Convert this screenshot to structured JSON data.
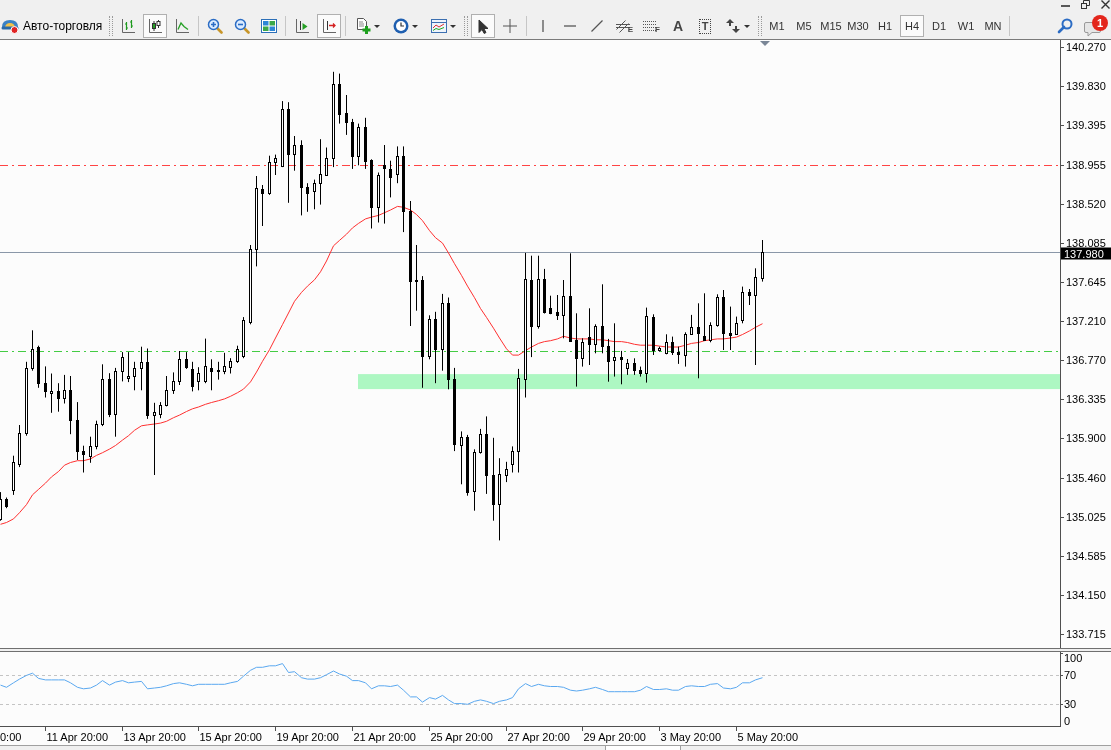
{
  "window_controls": [
    {
      "kind": "minimize"
    },
    {
      "kind": "restore"
    },
    {
      "kind": "close"
    }
  ],
  "toolbar": {
    "auto_trading": {
      "label": "Авто-торговля"
    },
    "groups": [
      {
        "separator": {
          "kind": "grip"
        },
        "tools": [
          {
            "kind": "bars",
            "on": false
          },
          {
            "kind": "candles",
            "on": true
          },
          {
            "kind": "line",
            "on": false
          }
        ]
      },
      {
        "separator": {
          "kind": "line"
        },
        "tools": [
          {
            "kind": "zoom-in",
            "on": false
          },
          {
            "kind": "zoom-out",
            "on": false
          },
          {
            "kind": "tile",
            "on": false
          }
        ]
      },
      {
        "separator": {
          "kind": "line"
        },
        "tools": [
          {
            "kind": "shift",
            "on": false
          },
          {
            "kind": "autoscroll",
            "on": true
          }
        ]
      },
      {
        "separator": {
          "kind": "line"
        },
        "tools": [
          {
            "kind": "new-chart",
            "on": false,
            "dropdown": true
          },
          {
            "kind": "periods",
            "on": false,
            "dropdown": true
          },
          {
            "kind": "template",
            "on": false,
            "dropdown": true
          }
        ]
      },
      {
        "separator": {
          "kind": "grip"
        },
        "tools": [
          {
            "kind": "cursor",
            "on": true
          },
          {
            "kind": "crosshair",
            "on": false
          }
        ]
      },
      {
        "separator": {
          "kind": "line"
        },
        "tools": [
          {
            "kind": "vline",
            "on": false
          },
          {
            "kind": "hline",
            "on": false
          },
          {
            "kind": "trendline",
            "on": false
          },
          {
            "kind": "channel",
            "on": false,
            "glyph": "E"
          },
          {
            "kind": "fibonacci",
            "on": false,
            "glyph": "F"
          },
          {
            "kind": "text",
            "on": false,
            "glyph": "A"
          },
          {
            "kind": "label",
            "on": false,
            "glyph": "T"
          },
          {
            "kind": "arrows",
            "on": false,
            "dropdown": true
          }
        ]
      }
    ],
    "timeframes_separator": {
      "kind": "grip"
    },
    "timeframes": [
      {
        "label": "M1",
        "selected": false
      },
      {
        "label": "M5",
        "selected": false
      },
      {
        "label": "M15",
        "selected": false
      },
      {
        "label": "M30",
        "selected": false
      },
      {
        "label": "H1",
        "selected": false
      },
      {
        "label": "H4",
        "selected": true
      },
      {
        "label": "D1",
        "selected": false
      },
      {
        "label": "W1",
        "selected": false
      },
      {
        "label": "MN",
        "selected": false
      }
    ],
    "end_separator": {
      "kind": "line"
    },
    "chat": {
      "badge": "1"
    }
  },
  "chart": {
    "time_axis": {
      "leading_label": "0:00",
      "labels": [
        "11 Apr 20:00",
        "13 Apr 20:00",
        "15 Apr 20:00",
        "19 Apr 20:00",
        "21 Apr 20:00",
        "25 Apr 20:00",
        "27 Apr 20:00",
        "29 Apr 20:00",
        "3 May 20:00",
        "5 May 20:00"
      ]
    },
    "chart_data": [
      {
        "type": "candlestick",
        "ylim": [
          133.559,
          140.348
        ],
        "tick_labels": "y",
        "yticks": [
          {
            "value": 140.27,
            "label": "140.270"
          },
          {
            "value": 139.83,
            "label": "139.830"
          },
          {
            "value": 139.395,
            "label": "139.395"
          },
          {
            "value": 138.955,
            "label": "138.955"
          },
          {
            "value": 138.52,
            "label": "138.520"
          },
          {
            "value": 138.085,
            "label": "138.085"
          },
          {
            "value": 137.645,
            "label": "137.645"
          },
          {
            "value": 137.21,
            "label": "137.210"
          },
          {
            "value": 136.77,
            "label": "136.770"
          },
          {
            "value": 136.335,
            "label": "136.335"
          },
          {
            "value": 135.9,
            "label": "135.900"
          },
          {
            "value": 135.46,
            "label": "135.460"
          },
          {
            "value": 135.025,
            "label": "135.025"
          },
          {
            "value": 134.585,
            "label": "134.585"
          },
          {
            "value": 134.15,
            "label": "134.150"
          },
          {
            "value": 133.715,
            "label": "133.715"
          }
        ],
        "ref_lines": [
          {
            "axis": "y",
            "value": 138.955,
            "color": "#ff4444",
            "line_style": "dashdot"
          },
          {
            "axis": "y",
            "value": 136.875,
            "color": "#44cc44",
            "line_style": "dashdot"
          },
          {
            "axis": "y",
            "value": 137.98,
            "color": "#8a97a8",
            "line_style": "solid",
            "label": "137.980"
          }
        ],
        "bands": [
          {
            "axis": "y",
            "from": 136.45,
            "to": 136.617,
            "color": "#adf7c2"
          }
        ],
        "series": [
          {
            "type": "line",
            "color": "#ff3030",
            "values": [
              134.94,
              134.96,
              135.0,
              135.07,
              135.16,
              135.27,
              135.33,
              135.4,
              135.47,
              135.53,
              135.6,
              135.63,
              135.65,
              135.65,
              135.67,
              135.71,
              135.74,
              135.78,
              135.82,
              135.88,
              135.93,
              135.99,
              136.04,
              136.05,
              136.06,
              136.07,
              136.09,
              136.13,
              136.16,
              136.2,
              136.23,
              136.25,
              136.28,
              136.3,
              136.32,
              136.34,
              136.37,
              136.41,
              136.45,
              136.53,
              136.64,
              136.76,
              136.89,
              137.02,
              137.17,
              137.3,
              137.43,
              137.53,
              137.6,
              137.67,
              137.76,
              137.88,
              138.05,
              138.11,
              138.18,
              138.25,
              138.3,
              138.35,
              138.37,
              138.39,
              138.42,
              138.45,
              138.49,
              138.48,
              138.45,
              138.4,
              138.33,
              138.22,
              138.14,
              138.08,
              137.97,
              137.85,
              137.72,
              137.6,
              137.47,
              137.35,
              137.25,
              137.13,
              137.02,
              136.9,
              136.83,
              136.83,
              136.88,
              136.92,
              136.96,
              136.98,
              136.99,
              137.01,
              137.04,
              137.02,
              137.01,
              137.01,
              137.01,
              137.0,
              137.0,
              136.99,
              136.98,
              136.98,
              136.97,
              136.95,
              136.94,
              136.94,
              136.94,
              136.93,
              136.92,
              136.92,
              136.92,
              136.94,
              136.96,
              136.97,
              136.99,
              137.0,
              137.01,
              137.01,
              137.02,
              137.03,
              137.06,
              137.1,
              137.14,
              137.18
            ]
          },
          {
            "type": "candlestick",
            "ohlc": [
              [
                135.0,
                135.3,
                134.981,
                135.22
              ],
              [
                135.22,
                135.24,
                135.12,
                135.14
              ],
              [
                135.32,
                135.706,
                135.268,
                135.638
              ],
              [
                135.619,
                136.049,
                135.579,
                135.958
              ],
              [
                135.958,
                136.755,
                135.93,
                136.687
              ],
              [
                136.687,
                137.106,
                136.655,
                136.895
              ],
              [
                136.915,
                136.935,
                136.464,
                136.516
              ],
              [
                136.516,
                136.703,
                136.356,
                136.424
              ],
              [
                136.404,
                136.624,
                136.185,
                136.428
              ],
              [
                136.424,
                136.516,
                136.197,
                136.356
              ],
              [
                136.356,
                136.608,
                136.289,
                136.444
              ],
              [
                136.436,
                136.596,
                135.946,
                136.105
              ],
              [
                136.105,
                136.305,
                135.658,
                135.758
              ],
              [
                135.758,
                135.818,
                135.519,
                135.73
              ],
              [
                135.698,
                135.918,
                135.627,
                135.818
              ],
              [
                135.818,
                136.097,
                135.778,
                136.057
              ],
              [
                136.057,
                136.727,
                136.037,
                136.568
              ],
              [
                136.568,
                136.628,
                136.137,
                136.169
              ],
              [
                136.169,
                136.687,
                135.918,
                136.648
              ],
              [
                136.648,
                136.863,
                136.536,
                136.803
              ],
              [
                136.576,
                136.863,
                136.528,
                136.6
              ],
              [
                136.596,
                136.755,
                136.436,
                136.687
              ],
              [
                136.687,
                136.923,
                136.436,
                136.755
              ],
              [
                136.755,
                136.903,
                136.117,
                136.157
              ],
              [
                136.157,
                136.297,
                135.491,
                136.193
              ],
              [
                136.177,
                136.305,
                136.125,
                136.277
              ],
              [
                136.277,
                136.596,
                136.257,
                136.436
              ],
              [
                136.436,
                136.636,
                136.396,
                136.536
              ],
              [
                136.536,
                136.875,
                136.496,
                136.783
              ],
              [
                136.783,
                136.863,
                136.675,
                136.695
              ],
              [
                136.675,
                136.755,
                136.424,
                136.488
              ],
              [
                136.536,
                136.695,
                136.436,
                136.628
              ],
              [
                136.544,
                137.014,
                136.516,
                136.703
              ],
              [
                136.687,
                136.783,
                136.436,
                136.655
              ],
              [
                136.663,
                136.755,
                136.556,
                136.648
              ],
              [
                136.648,
                136.855,
                136.616,
                136.703
              ],
              [
                136.695,
                136.795,
                136.624,
                136.763
              ],
              [
                136.763,
                136.935,
                136.743,
                136.895
              ],
              [
                136.823,
                137.254,
                136.795,
                137.222
              ],
              [
                137.202,
                138.059,
                137.174,
                138.019
              ],
              [
                138.019,
                138.829,
                137.82,
                138.697
              ],
              [
                138.689,
                138.729,
                138.271,
                138.642
              ],
              [
                138.642,
                139.056,
                138.618,
                138.988
              ],
              [
                138.988,
                139.068,
                138.841,
                139.028
              ],
              [
                138.937,
                139.666,
                138.929,
                139.575
              ],
              [
                139.575,
                139.654,
                138.53,
                139.076
              ],
              [
                139.08,
                139.276,
                138.889,
                139.176
              ],
              [
                139.176,
                139.228,
                138.39,
                138.709
              ],
              [
                138.709,
                138.749,
                138.43,
                138.642
              ],
              [
                138.657,
                138.789,
                138.458,
                138.749
              ],
              [
                138.749,
                139.24,
                138.51,
                138.857
              ],
              [
                138.841,
                139.148,
                138.829,
                139.028
              ],
              [
                139.028,
                139.993,
                138.929,
                139.854
              ],
              [
                139.854,
                139.973,
                139.415,
                139.527
              ],
              [
                139.535,
                139.734,
                139.288,
                139.427
              ],
              [
                139.427,
                139.467,
                138.909,
                139.048
              ],
              [
                139.048,
                139.415,
                138.949,
                139.375
              ],
              [
                139.375,
                139.479,
                138.909,
                139.0
              ],
              [
                139.008,
                139.016,
                138.243,
                138.482
              ],
              [
                138.482,
                138.869,
                138.31,
                138.841
              ],
              [
                138.949,
                139.176,
                138.298,
                138.921
              ],
              [
                138.909,
                139.0,
                138.59,
                138.817
              ],
              [
                138.857,
                139.16,
                138.749,
                139.056
              ],
              [
                139.056,
                139.16,
                138.203,
                138.442
              ],
              [
                138.442,
                138.55,
                137.154,
                137.652
              ],
              [
                137.652,
                138.059,
                137.325,
                137.672
              ],
              [
                137.672,
                137.712,
                136.464,
                136.815
              ],
              [
                136.815,
                137.274,
                136.783,
                137.234
              ],
              [
                137.234,
                137.313,
                136.516,
                136.895
              ],
              [
                136.895,
                137.513,
                136.655,
                137.413
              ],
              [
                137.413,
                137.473,
                136.448,
                136.568
              ],
              [
                136.568,
                136.687,
                135.758,
                135.838
              ],
              [
                135.826,
                135.978,
                135.387,
                135.918
              ],
              [
                135.918,
                135.938,
                135.26,
                135.3
              ],
              [
                135.308,
                135.778,
                135.092,
                135.746
              ],
              [
                135.746,
                136.005,
                135.73,
                135.946
              ],
              [
                135.946,
                136.145,
                135.28,
                135.491
              ],
              [
                135.491,
                135.906,
                134.981,
                135.172
              ],
              [
                135.172,
                135.678,
                134.761,
                135.499
              ],
              [
                135.491,
                135.638,
                135.411,
                135.559
              ],
              [
                135.611,
                135.81,
                135.519,
                135.758
              ],
              [
                135.758,
                136.675,
                135.519,
                136.576
              ],
              [
                136.568,
                137.971,
                136.356,
                137.684
              ],
              [
                137.672,
                137.94,
                136.807,
                137.154
              ],
              [
                137.154,
                137.94,
                137.126,
                137.684
              ],
              [
                137.684,
                137.792,
                137.294,
                137.313
              ],
              [
                137.353,
                137.493,
                137.286,
                137.302
              ],
              [
                137.313,
                137.501,
                137.222,
                137.274
              ],
              [
                137.278,
                137.668,
                137.017,
                137.49
              ],
              [
                137.49,
                137.966,
                136.98,
                136.987
              ],
              [
                136.999,
                137.296,
                136.478,
                136.794
              ],
              [
                136.794,
                137.017,
                136.701,
                136.973
              ],
              [
                137.028,
                137.352,
                136.719,
                136.95
              ],
              [
                136.95,
                137.174,
                136.85,
                137.159
              ],
              [
                137.159,
                137.62,
                136.85,
                136.932
              ],
              [
                136.932,
                137.01,
                136.533,
                136.764
              ],
              [
                136.772,
                137.185,
                136.589,
                136.805
              ],
              [
                136.805,
                136.876,
                136.504,
                136.786
              ],
              [
                136.682,
                136.786,
                136.608,
                136.738
              ],
              [
                136.738,
                136.794,
                136.608,
                136.664
              ],
              [
                136.664,
                136.701,
                136.589,
                136.626
              ],
              [
                136.626,
                137.36,
                136.522,
                137.267
              ],
              [
                137.255,
                137.285,
                136.831,
                136.883
              ],
              [
                136.883,
                136.924,
                136.868,
                136.906
              ],
              [
                136.85,
                137.062,
                136.839,
                136.973
              ],
              [
                136.973,
                137.036,
                136.831,
                136.868
              ],
              [
                136.868,
                136.924,
                136.731,
                136.839
              ],
              [
                136.831,
                137.084,
                136.701,
                137.062
              ],
              [
                137.062,
                137.278,
                137.054,
                137.147
              ],
              [
                137.147,
                137.408,
                136.571,
                137.073
              ],
              [
                137.043,
                137.52,
                136.987,
                136.999
              ],
              [
                136.999,
                137.196,
                136.973,
                137.166
              ],
              [
                137.166,
                137.508,
                137.147,
                137.475
              ],
              [
                137.475,
                137.557,
                136.887,
                137.073
              ],
              [
                137.073,
                137.371,
                136.887,
                137.058
              ],
              [
                137.062,
                137.259,
                137.054,
                137.185
              ],
              [
                137.222,
                137.594,
                137.185,
                137.531
              ],
              [
                137.531,
                137.568,
                137.389,
                137.501
              ],
              [
                137.501,
                137.799,
                136.719,
                137.702
              ],
              [
                137.687,
                138.115,
                137.65,
                137.98
              ]
            ]
          }
        ]
      },
      {
        "type": "line",
        "ylim": [
          0,
          100
        ],
        "yticks": [
          100,
          70,
          30,
          0
        ],
        "tick_labels": "y",
        "color": "#5aa8f0",
        "ref_lines": [
          {
            "axis": "y",
            "value": 70,
            "color": "#c4c4c4",
            "line_style": "dashed"
          },
          {
            "axis": "y",
            "value": 30,
            "color": "#c4c4c4",
            "line_style": "dashed"
          }
        ],
        "values": [
          56,
          53,
          59,
          64,
          69,
          72,
          65,
          63,
          63,
          63,
          63,
          59,
          53,
          51,
          52,
          56,
          62,
          56,
          60,
          62,
          59,
          60,
          61,
          51,
          52,
          53,
          55,
          58,
          59,
          57,
          55,
          57,
          57,
          57,
          57,
          57,
          59,
          61,
          68,
          76,
          80,
          80,
          82,
          82,
          85,
          73,
          74,
          66,
          64,
          64,
          66,
          70,
          75,
          71,
          68,
          62,
          62,
          59,
          51,
          55,
          55,
          54,
          56,
          49,
          40,
          40,
          33,
          39,
          37,
          42,
          36,
          31,
          31,
          30,
          34,
          36,
          34,
          31,
          34,
          36,
          39,
          51,
          58,
          54,
          57,
          55,
          54,
          54,
          53,
          49,
          48,
          49,
          51,
          53,
          50,
          47,
          47,
          47,
          47,
          47,
          49,
          54,
          50,
          50,
          51,
          49,
          49,
          54,
          55,
          54,
          54,
          57,
          58,
          52,
          51,
          53,
          59,
          59,
          63,
          66
        ]
      }
    ]
  }
}
